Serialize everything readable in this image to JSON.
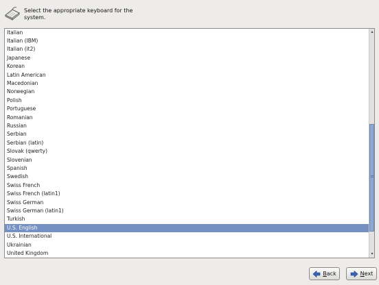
{
  "header": {
    "icon": "keyboard-icon",
    "title": "Select the appropriate keyboard for the system."
  },
  "keyboard_list": {
    "items": [
      "Italian",
      "Italian (IBM)",
      "Italian (it2)",
      "Japanese",
      "Korean",
      "Latin American",
      "Macedonian",
      "Norwegian",
      "Polish",
      "Portuguese",
      "Romanian",
      "Russian",
      "Serbian",
      "Serbian (latin)",
      "Slovak (qwerty)",
      "Slovenian",
      "Spanish",
      "Swedish",
      "Swiss French",
      "Swiss French (latin1)",
      "Swiss German",
      "Swiss German (latin1)",
      "Turkish",
      "U.S. English",
      "U.S. International",
      "Ukrainian",
      "United Kingdom"
    ],
    "selected": "U.S. English",
    "scroll_position": 0.82
  },
  "buttons": {
    "back": {
      "mnemonic": "B",
      "rest": "ack",
      "icon": "arrow-left-icon"
    },
    "next": {
      "mnemonic": "N",
      "rest": "ext",
      "icon": "arrow-right-icon"
    }
  },
  "colors": {
    "selection": "#7590c2",
    "background": "#edeceb",
    "icon_blue": "#3a64b4"
  }
}
